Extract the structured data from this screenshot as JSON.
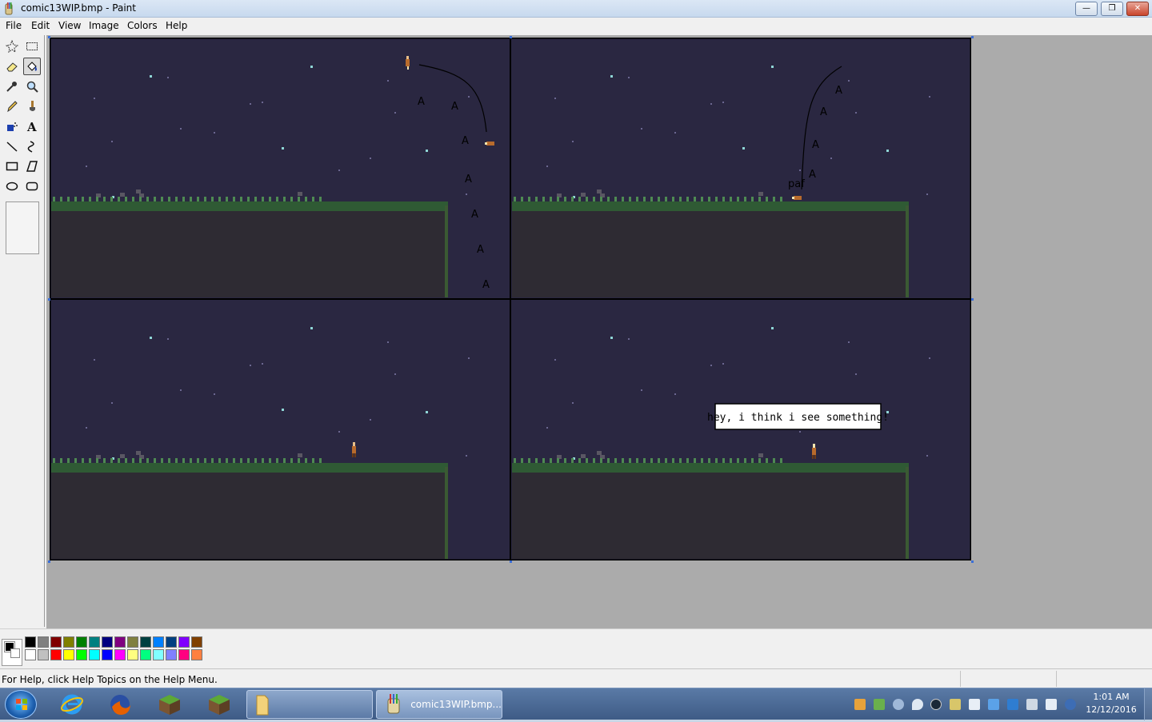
{
  "window": {
    "title": "comic13WIP.bmp - Paint",
    "min": "—",
    "max": "❐",
    "close": "✕"
  },
  "menu": [
    "File",
    "Edit",
    "View",
    "Image",
    "Colors",
    "Help"
  ],
  "tools": [
    "free-form-select",
    "select",
    "eraser",
    "fill-with-color",
    "pick-color",
    "magnifier",
    "pencil",
    "brush",
    "airbrush",
    "text",
    "line",
    "curve",
    "rectangle",
    "polygon",
    "ellipse",
    "rounded-rectangle"
  ],
  "selected_tool": "fill-with-color",
  "canvas": {
    "speech_bubble": "hey, i think i see something!",
    "sfx": "paf",
    "footstep_glyph": "A"
  },
  "palette": {
    "foreground": "#000000",
    "background": "#ffffff",
    "row1": [
      "#000000",
      "#808080",
      "#800000",
      "#808000",
      "#008000",
      "#008080",
      "#000080",
      "#800080",
      "#808040",
      "#004040",
      "#0080ff",
      "#004080",
      "#8000ff",
      "#804000"
    ],
    "row2": [
      "#ffffff",
      "#c0c0c0",
      "#ff0000",
      "#ffff00",
      "#00ff00",
      "#00ffff",
      "#0000ff",
      "#ff00ff",
      "#ffff80",
      "#00ff80",
      "#80ffff",
      "#8080ff",
      "#ff0080",
      "#ff8040"
    ]
  },
  "status": {
    "help_text": "For Help, click Help Topics on the Help Menu."
  },
  "taskbar": {
    "active_window_label": "comic13WIP.bmp...",
    "clock_time": "1:01 AM",
    "clock_date": "12/12/2016"
  },
  "colors": {
    "sky": "#2a2741",
    "grass": "#2f5a34",
    "dirt": "#2e2b33",
    "workspace": "#ababab"
  }
}
